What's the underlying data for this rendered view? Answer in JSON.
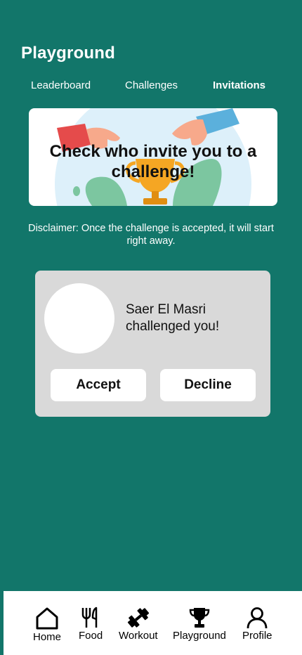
{
  "header": {
    "title": "Playground"
  },
  "tabs": [
    {
      "label": "Leaderboard",
      "active": false
    },
    {
      "label": "Challenges",
      "active": false
    },
    {
      "label": "Invitations",
      "active": true
    }
  ],
  "banner": {
    "text": "Check who invite you to a challenge!"
  },
  "disclaimer": "Disclaimer: Once the challenge is accepted, it will start right away.",
  "invitation": {
    "message": "Saer El Masri challenged you!",
    "accept_label": "Accept",
    "decline_label": "Decline"
  },
  "bottom_nav": [
    {
      "label": "Home",
      "icon": "home-icon"
    },
    {
      "label": "Food",
      "icon": "fork-knife-icon"
    },
    {
      "label": "Workout",
      "icon": "dumbbell-icon"
    },
    {
      "label": "Playground",
      "icon": "trophy-icon"
    },
    {
      "label": "Profile",
      "icon": "user-icon"
    }
  ],
  "colors": {
    "background": "#12766A",
    "card": "#D9D9D9",
    "surface": "#FFFFFF"
  }
}
